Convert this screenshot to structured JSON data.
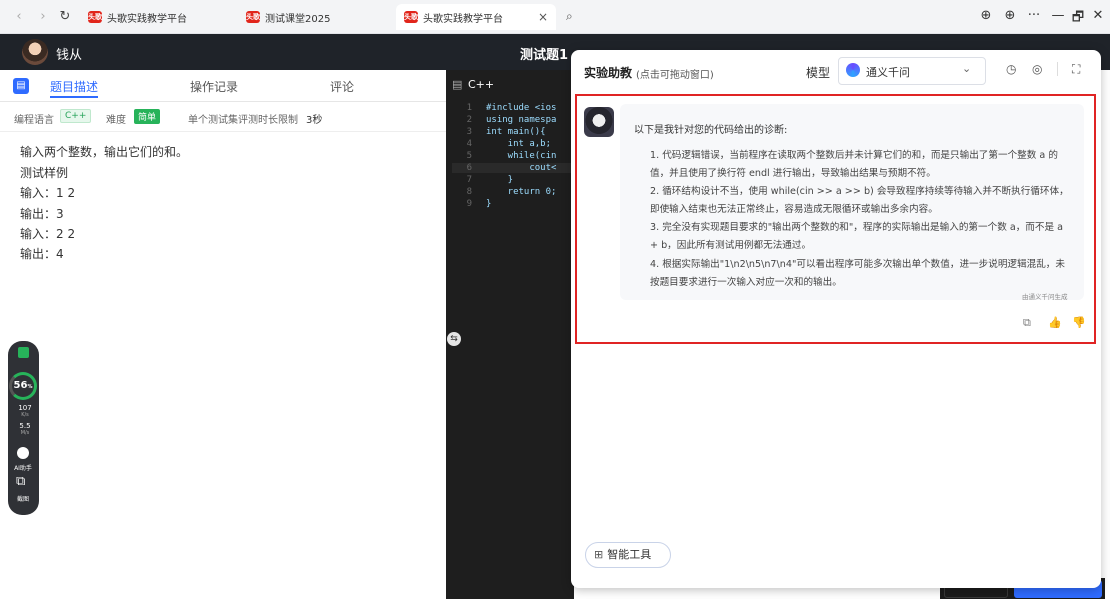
{
  "browser": {
    "tabs": [
      {
        "label": "头歌实践教学平台",
        "favicon": "头歌"
      },
      {
        "label": "测试课堂2025",
        "favicon": "头歌"
      },
      {
        "label": "头歌实践教学平台",
        "favicon": "头歌",
        "close": "×"
      }
    ],
    "search_glyph": "⌕",
    "window_buttons": [
      "⊕",
      "⊕",
      "···",
      "—",
      "🗗",
      "✕"
    ]
  },
  "header": {
    "username": "钱从",
    "problem_title": "测试题1"
  },
  "left_panel": {
    "tabs": [
      "题目描述",
      "操作记录",
      "评论"
    ],
    "info": {
      "lang_label": "编程语言",
      "lang_value": "C++",
      "difficulty_label": "难度",
      "difficulty_value": "简单",
      "time_limit": "单个测试集评测时长限制",
      "time_value": "3秒"
    },
    "description": [
      "输入两个整数，输出它们的和。",
      "测试样例",
      "输入：1 2",
      "输出：3",
      "输入：2 2",
      "输出：4"
    ]
  },
  "widget": {
    "percent": "56",
    "percent_unit": "%",
    "up_value": "107",
    "up_unit": "K/s",
    "down_value": "5.5",
    "down_unit": "M/s",
    "ai_label": "AI助手",
    "shot_label": "截图"
  },
  "editor": {
    "tab_label": "C++",
    "lines": [
      {
        "n": "1",
        "code": "#include <ios"
      },
      {
        "n": "2",
        "code": "using namespa"
      },
      {
        "n": "3",
        "code": "int main(){"
      },
      {
        "n": "4",
        "code": "    int a,b;"
      },
      {
        "n": "5",
        "code": "    while(cin"
      },
      {
        "n": "6",
        "code": "        cout<"
      },
      {
        "n": "7",
        "code": "    }"
      },
      {
        "n": "8",
        "code": "    return 0;"
      },
      {
        "n": "9",
        "code": "}"
      }
    ]
  },
  "assistant": {
    "title": "实验助教",
    "subtitle": "(点击可拖动窗口)",
    "model_label": "模型",
    "model_value": "通义千问",
    "intro": "以下是我针对您的代码给出的诊断:",
    "items": [
      "1. 代码逻辑错误，当前程序在读取两个整数后并未计算它们的和，而是只输出了第一个整数 a 的值，并且使用了换行符 endl 进行输出，导致输出结果与预期不符。",
      "2. 循环结构设计不当，使用 while(cin >> a >> b) 会导致程序持续等待输入并不断执行循环体，即使输入结束也无法正常终止，容易造成无限循环或输出多余内容。",
      "3. 完全没有实现题目要求的\"输出两个整数的和\"，程序的实际输出是输入的第一个数 a，而不是 a + b，因此所有测试用例都无法通过。",
      "4. 根据实际输出\"1\\n2\\n5\\n7\\n4\"可以看出程序可能多次输出单个数值，进一步说明逻辑混乱，未按题目要求进行一次输入对应一次和的输出。"
    ],
    "generated_by": "由通义千问生成",
    "smart_tool": "智能工具"
  },
  "colors": {
    "accent": "#2f6bff",
    "highlight": "#e02424"
  }
}
